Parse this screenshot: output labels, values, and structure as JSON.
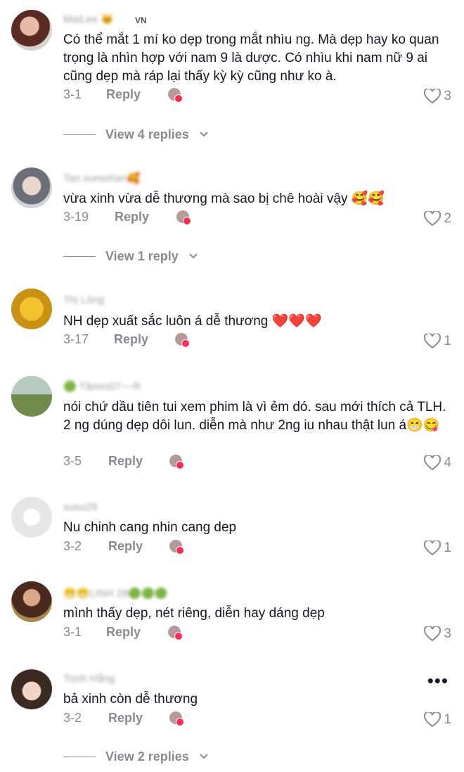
{
  "comments": [
    {
      "username": "MaiLee 🐱",
      "flag": "VN",
      "text": "Có thể mắt 1 mí ko dẹp trong mắt nhìu ng. Mà dẹp hay ko quan trọng là nhìn hợp với nam 9 là dược. Có nhìu khi nam nữ 9 ai cũng dẹp mà ráp lại thấy kỳ kỳ cũng như ko à.",
      "date": "3-1",
      "reply": "Reply",
      "likes": "3",
      "view_replies": "View 4 replies"
    },
    {
      "username": "Tan xuroohan🥰",
      "text": "vừa xinh vừa dễ thương mà sao bị chê hoài vậy 🥰🥰",
      "date": "3-19",
      "reply": "Reply",
      "likes": "2",
      "view_replies": "View 1 reply"
    },
    {
      "username": "Thị Lòng",
      "text": "NH dẹp xuất sắc luôn á dễ thương ❤️❤️❤️",
      "date": "3-17",
      "reply": "Reply",
      "likes": "1"
    },
    {
      "username": "🟢 Tâmm07~~R",
      "text": "nói chứ dầu tiên tui xem phim là vì ẻm dó. sau mới thích cả TLH. 2 ng dúng dẹp dôi lun. diễn mà như 2ng iu nhau thật lun á😁😋",
      "date": "3-5",
      "reply": "Reply",
      "likes": "4"
    },
    {
      "username": "susu29",
      "text": "Nu chinh cang nhin cang dep",
      "date": "3-2",
      "reply": "Reply",
      "likes": "1"
    },
    {
      "username": "😁😁LINH 28🟢🟢🟢",
      "text": "mình thấy dẹp, nét riêng, diễn hay dáng dẹp",
      "date": "3-1",
      "reply": "Reply",
      "likes": "3"
    },
    {
      "username": "Trịnh Hằng",
      "text": "bả xinh còn dễ thương",
      "date": "3-2",
      "reply": "Reply",
      "likes": "1",
      "view_replies": "View 2 replies",
      "more": "•••"
    }
  ],
  "colors": {
    "text": "#161823",
    "muted": "#8a8b91",
    "creator_badge": "#fe2c55"
  }
}
